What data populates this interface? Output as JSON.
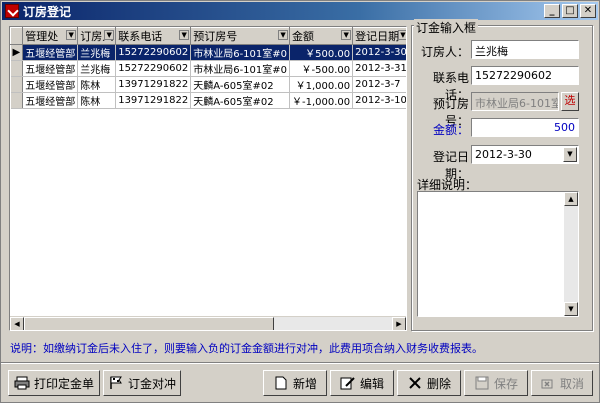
{
  "window": {
    "title": "订房登记"
  },
  "grid": {
    "columns": [
      "管理处",
      "订房人",
      "联系电话",
      "预订房号",
      "金额",
      "登记日期"
    ],
    "rows": [
      {
        "dept": "五堰经管部",
        "person": "兰兆梅",
        "phone": "15272290602",
        "room": "市林业局6-101室#0",
        "amount": "￥500.00",
        "date": "2012-3-30"
      },
      {
        "dept": "五堰经管部",
        "person": "兰兆梅",
        "phone": "15272290602",
        "room": "市林业局6-101室#0",
        "amount": "￥-500.00",
        "date": "2012-3-31"
      },
      {
        "dept": "五堰经管部",
        "person": "陈林",
        "phone": "13971291822",
        "room": "天麟A-605室#02",
        "amount": "￥1,000.00",
        "date": "2012-3-7"
      },
      {
        "dept": "五堰经管部",
        "person": "陈林",
        "phone": "13971291822",
        "room": "天麟A-605室#02",
        "amount": "￥-1,000.00",
        "date": "2012-3-10"
      }
    ]
  },
  "form": {
    "group_title": "订金输入框",
    "person_label": "订房人：",
    "person_value": "兰兆梅",
    "phone_label": "联系电话：",
    "phone_value": "15272290602",
    "room_label": "预订房号：",
    "room_value": "市林业局6-101室",
    "select_label": "选",
    "amount_label": "金额：",
    "amount_value": "500",
    "date_label": "登记日期：",
    "date_value": "2012-3-30",
    "detail_label": "详细说明："
  },
  "note": "说明：如缴纳订金后未入住了，则要输入负的订金金额进行对冲，此费用项合纳入财务收费报表。",
  "buttons": {
    "print": "打印定金单",
    "offset": "订金对冲",
    "add": "新增",
    "edit": "编辑",
    "delete": "删除",
    "save": "保存",
    "cancel": "取消"
  },
  "colors": {
    "title_start": "#0a246a",
    "selection": "#0a246a",
    "note_text": "#0000c0",
    "select_btn": "#c00000"
  }
}
